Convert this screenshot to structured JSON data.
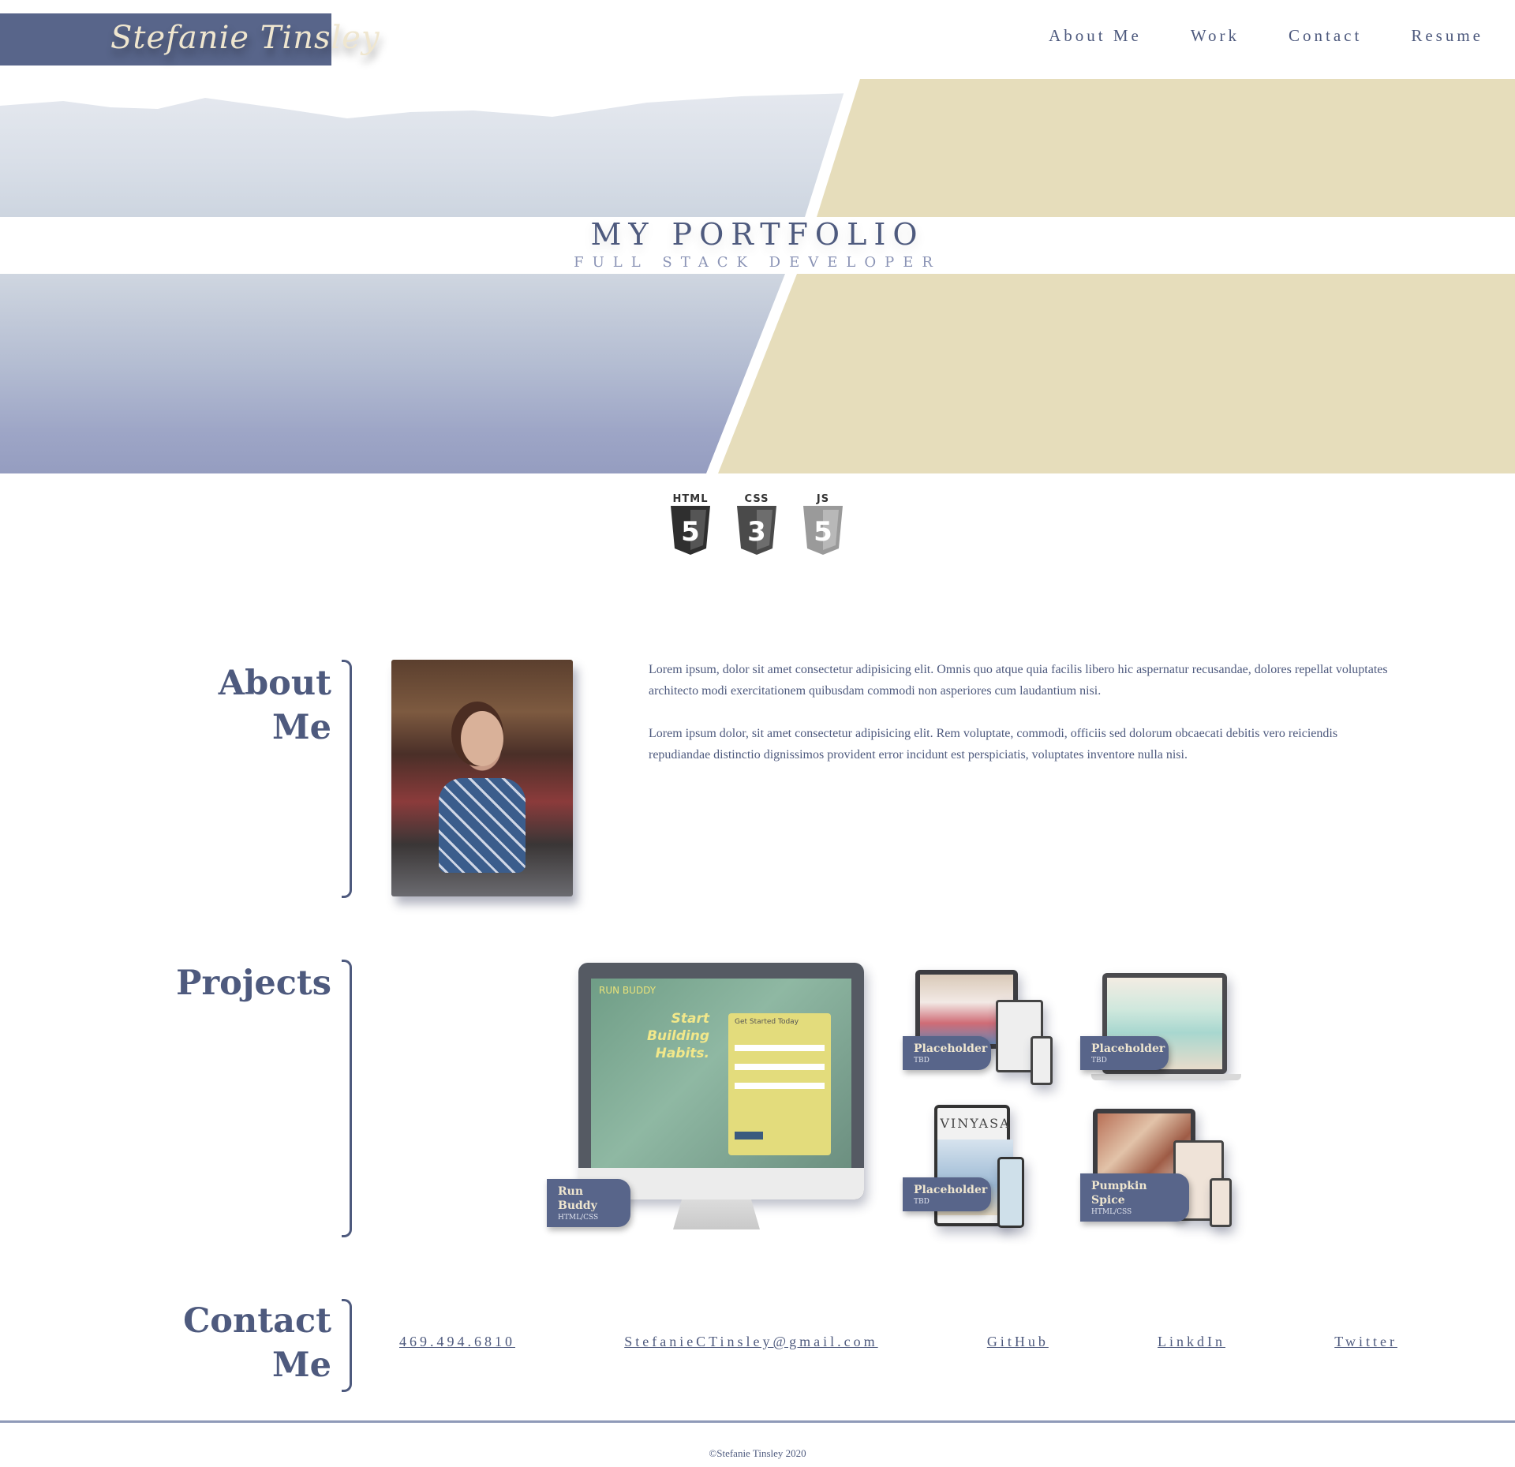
{
  "header": {
    "logo_text": "Stefanie Tinsley",
    "nav": [
      "About Me",
      "Work",
      "Contact",
      "Resume"
    ]
  },
  "hero": {
    "title": "MY PORTFOLIO",
    "subtitle": "FULL STACK DEVELOPER"
  },
  "tech": [
    {
      "label": "HTML",
      "glyph": "5",
      "color": "#2f2f2f"
    },
    {
      "label": "CSS",
      "glyph": "3",
      "color": "#4a4a4a"
    },
    {
      "label": "JS",
      "glyph": "5",
      "color": "#9a9a9a"
    }
  ],
  "about": {
    "title_line1": "About",
    "title_line2": "Me",
    "paragraph1": "Lorem ipsum, dolor sit amet consectetur adipisicing elit. Omnis quo atque quia facilis libero hic aspernatur recusandae, dolores repellat voluptates architecto modi exercitationem quibusdam commodi non asperiores cum laudantium nisi.",
    "paragraph2": "Lorem ipsum dolor, sit amet consectetur adipisicing elit. Rem voluptate, commodi, officiis sed dolorum obcaecati debitis vero reiciendis repudiandae distinctio dignissimos provident error incidunt est perspiciatis, voluptates inventore nulla nisi."
  },
  "projects": {
    "title": "Projects",
    "items": [
      {
        "name": "Run Buddy",
        "tech": "HTML/CSS",
        "screen_heading": "Start Building Habits.",
        "screen_brand": "RUN BUDDY",
        "form_title": "Get Started Today"
      },
      {
        "name": "Placeholder",
        "tech": "TBD"
      },
      {
        "name": "Placeholder",
        "tech": "TBD"
      },
      {
        "name": "Placeholder",
        "tech": "TBD",
        "screen_heading": "VINYASA"
      },
      {
        "name": "Pumpkin Spice",
        "tech": "HTML/CSS"
      }
    ]
  },
  "contact": {
    "title_line1": "Contact",
    "title_line2": "Me",
    "links": [
      "469.494.6810",
      "StefanieCTinsley@gmail.com",
      "GitHub",
      "LinkdIn",
      "Twitter"
    ]
  },
  "footer": {
    "text": "©Stefanie Tinsley 2020"
  },
  "colors": {
    "brand": "#58658a",
    "accent_tan": "#e6ddbb",
    "text": "#4e5a7e"
  }
}
